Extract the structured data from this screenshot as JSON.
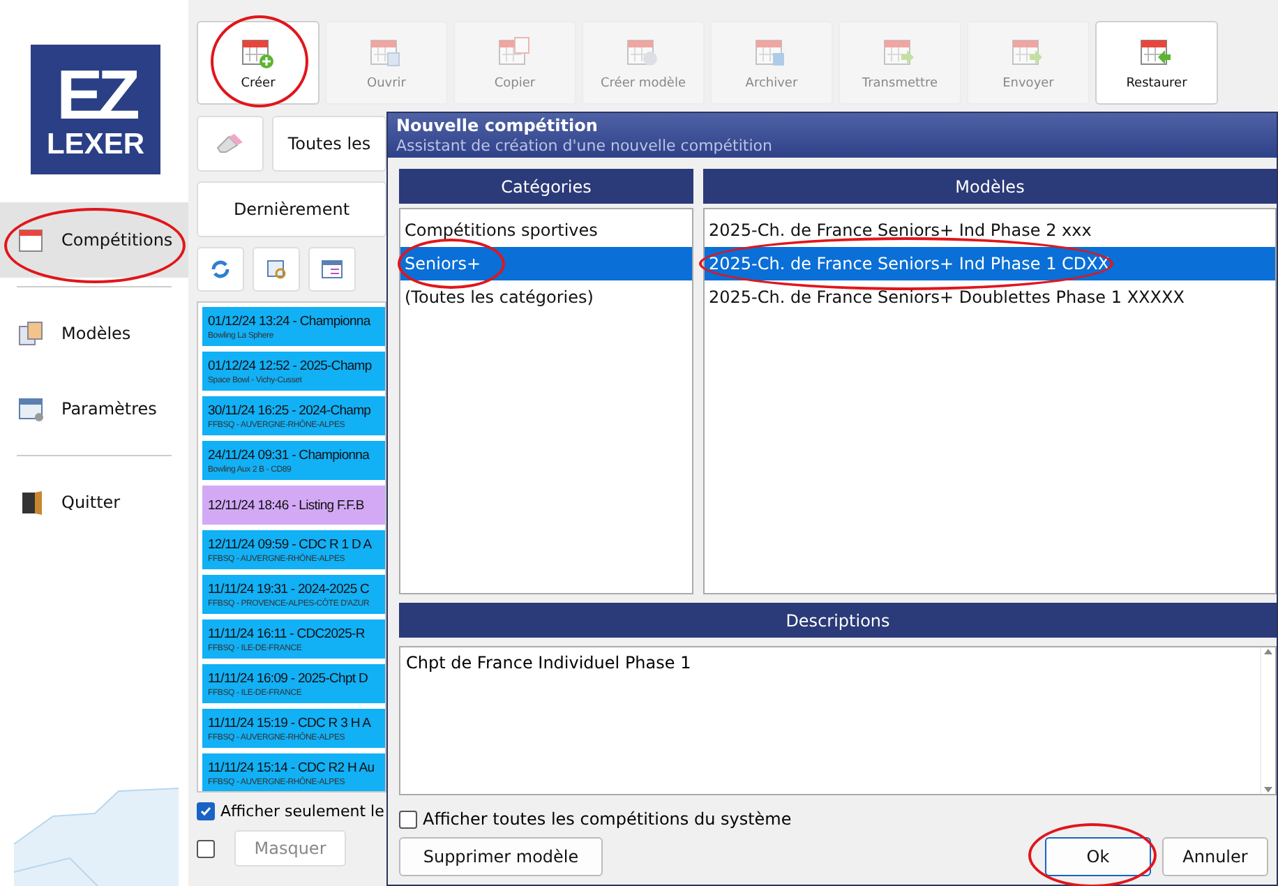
{
  "sidebar": {
    "logo": {
      "letters": "EZ",
      "word": "LEXER"
    },
    "items": [
      {
        "label": "Compétitions",
        "kind": "calendar",
        "selected": true,
        "circled": true
      },
      {
        "label": "Modèles",
        "kind": "templates",
        "selected": false,
        "circled": false
      },
      {
        "label": "Paramètres",
        "kind": "settings",
        "selected": false,
        "circled": false
      },
      {
        "label": "Quitter",
        "kind": "door",
        "selected": false,
        "circled": false
      }
    ]
  },
  "toolbar": [
    {
      "label": "Créer",
      "kind": "plus",
      "enabled": true,
      "circled": true
    },
    {
      "label": "Ouvrir",
      "kind": "pages",
      "enabled": false,
      "circled": false
    },
    {
      "label": "Copier",
      "kind": "copy",
      "enabled": false,
      "circled": false
    },
    {
      "label": "Créer modèle",
      "kind": "database",
      "enabled": false,
      "circled": false
    },
    {
      "label": "Archiver",
      "kind": "disk",
      "enabled": false,
      "circled": false
    },
    {
      "label": "Transmettre",
      "kind": "arrow-right",
      "enabled": false,
      "circled": false
    },
    {
      "label": "Envoyer",
      "kind": "arrow-right",
      "enabled": false,
      "circled": false
    },
    {
      "label": "Restaurer",
      "kind": "arrow-left",
      "enabled": true,
      "circled": false
    }
  ],
  "filter_button": "Toutes les",
  "sort_button": "Dernièrement",
  "competitions": [
    {
      "title": "01/12/24 13:24 - Championna",
      "place": "Bowling La Sphere",
      "color": "#12b0f5"
    },
    {
      "title": "01/12/24 12:52 - 2025-Champ",
      "place": "Space Bowl - Vichy-Cusset",
      "color": "#12b0f5"
    },
    {
      "title": "30/11/24 16:25 - 2024-Champ",
      "place": "FFBSQ - AUVERGNE-RHÔNE-ALPES",
      "color": "#12b0f5"
    },
    {
      "title": "24/11/24 09:31 - Championna",
      "place": "Bowling Aux 2 B - CD89",
      "color": "#12b0f5"
    },
    {
      "title": "12/11/24 18:46 - Listing F.F.B",
      "color": "#d3a9f5"
    },
    {
      "title": "12/11/24 09:59 - CDC R 1 D A",
      "place": "FFBSQ - AUVERGNE-RHÔNE-ALPES",
      "color": "#12b0f5"
    },
    {
      "title": "11/11/24 19:31 - 2024-2025 C",
      "place": "FFBSQ - PROVENCE-ALPES-CÔTE D'AZUR",
      "color": "#12b0f5"
    },
    {
      "title": "11/11/24 16:11 - CDC2025-R",
      "place": "FFBSQ - ILE-DE-FRANCE",
      "color": "#12b0f5"
    },
    {
      "title": "11/11/24 16:09 - 2025-Chpt D",
      "place": "FFBSQ - ILE-DE-FRANCE",
      "color": "#12b0f5"
    },
    {
      "title": "11/11/24 15:19 - CDC R 3 H A",
      "place": "FFBSQ - AUVERGNE-RHÔNE-ALPES",
      "color": "#12b0f5"
    },
    {
      "title": "11/11/24 15:14 - CDC R2 H Au",
      "place": "FFBSQ - AUVERGNE-RHÔNE-ALPES",
      "color": "#12b0f5"
    }
  ],
  "only_checkbox": {
    "label": "Afficher seulement le",
    "checked": true
  },
  "hide_checkbox": {
    "checked": false
  },
  "hide_button": "Masquer",
  "dialog": {
    "title": "Nouvelle compétition",
    "subtitle": "Assistant de création d'une nouvelle compétition",
    "categories_header": "Catégories",
    "categories": [
      {
        "label": "Compétitions sportives",
        "selected": false,
        "circled": false
      },
      {
        "label": "Seniors+",
        "selected": true,
        "circled": true
      },
      {
        "label": "(Toutes les catégories)",
        "selected": false,
        "circled": false
      }
    ],
    "models_header": "Modèles",
    "models": [
      {
        "label": "2025-Ch. de France Seniors+ Ind Phase 2 xxx",
        "selected": false,
        "circled": false
      },
      {
        "label": "2025-Ch. de France Seniors+ Ind Phase 1 CDXX",
        "selected": true,
        "circled": true
      },
      {
        "label": "2025-Ch. de France Seniors+ Doublettes Phase 1 XXXXX",
        "selected": false,
        "circled": false
      }
    ],
    "descriptions_header": "Descriptions",
    "description": "Chpt de France Individuel Phase 1",
    "show_all": {
      "label": "Afficher toutes les compétitions du système",
      "checked": false
    },
    "delete_button": "Supprimer modèle",
    "ok_button": {
      "label": "Ok",
      "circled": true
    },
    "cancel_button": "Annuler"
  }
}
